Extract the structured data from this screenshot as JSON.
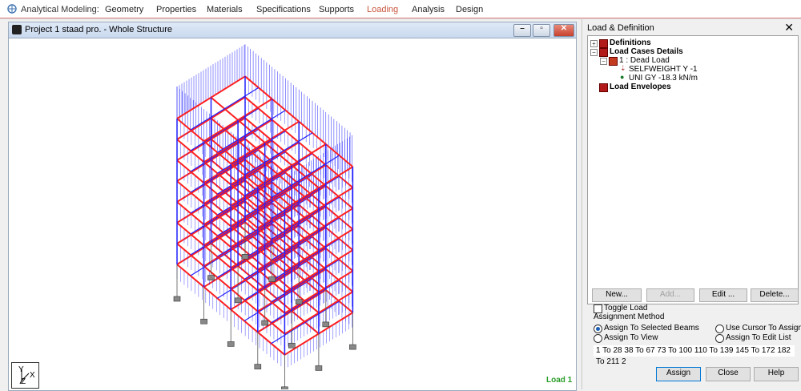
{
  "ribbon": {
    "title": "Analytical Modeling:",
    "menu": [
      "Geometry",
      "Properties",
      "Materials",
      "Specifications",
      "Supports",
      "Loading",
      "Analysis",
      "Design"
    ],
    "active": "Loading"
  },
  "viewport": {
    "title": "Project 1 staad pro. - Whole Structure",
    "buttons": [
      "minimize-icon",
      "restore-icon",
      "close-icon"
    ],
    "load_label": "Load 1",
    "axes": {
      "y": "Y",
      "x": "X",
      "z": "Z"
    }
  },
  "panel": {
    "title": "Load & Definition",
    "tree": {
      "definitions": "Definitions",
      "load_cases_details": "Load Cases Details",
      "dead_load": "1 : Dead Load",
      "selfweight": "SELFWEIGHT Y -1",
      "uni": "UNI GY -18.3 kN/m",
      "load_envelopes": "Load Envelopes"
    },
    "buttons": {
      "new": "New...",
      "add": "Add...",
      "edit": "Edit ...",
      "delete": "Delete..."
    },
    "toggle_load": "Toggle Load",
    "assignment_method": "Assignment Method",
    "options": {
      "selected_beams": "Assign To Selected Beams",
      "cursor": "Use Cursor To Assign",
      "view": "Assign To View",
      "edit_list": "Assign To Edit List"
    },
    "edit_list_value": "1 To 28 38 To 67 73 To 100 110 To 139 145 To 172 182 To 211 2",
    "footer": {
      "assign": "Assign",
      "close": "Close",
      "help": "Help"
    }
  },
  "colors": {
    "beam_blue": "#2020ff",
    "load_red": "#ff2020",
    "active_tab": "#c8553d",
    "load_label": "#2a9d2a"
  }
}
